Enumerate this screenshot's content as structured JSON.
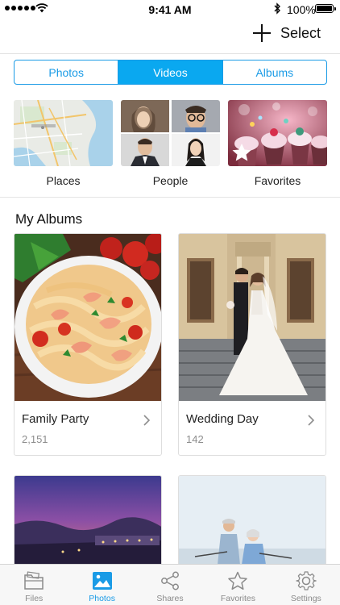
{
  "status_bar": {
    "time": "9:41 AM",
    "battery": "100%"
  },
  "nav": {
    "select_label": "Select"
  },
  "segmented": {
    "items": [
      "Photos",
      "Videos",
      "Albums"
    ],
    "selected": "Videos"
  },
  "categories": [
    {
      "label": "Places"
    },
    {
      "label": "People"
    },
    {
      "label": "Favorites"
    }
  ],
  "section_title": "My Albums",
  "albums": [
    {
      "name": "Family Party",
      "count": "2,151"
    },
    {
      "name": "Wedding Day",
      "count": "142"
    }
  ],
  "tabs": [
    {
      "label": "Files",
      "icon": "folder-icon"
    },
    {
      "label": "Photos",
      "icon": "photo-icon"
    },
    {
      "label": "Shares",
      "icon": "share-icon"
    },
    {
      "label": "Favorites",
      "icon": "star-icon"
    },
    {
      "label": "Settings",
      "icon": "gear-icon"
    }
  ],
  "active_tab": "Photos",
  "colors": {
    "accent": "#1a9be6",
    "segment_active": "#0aa8f0"
  }
}
